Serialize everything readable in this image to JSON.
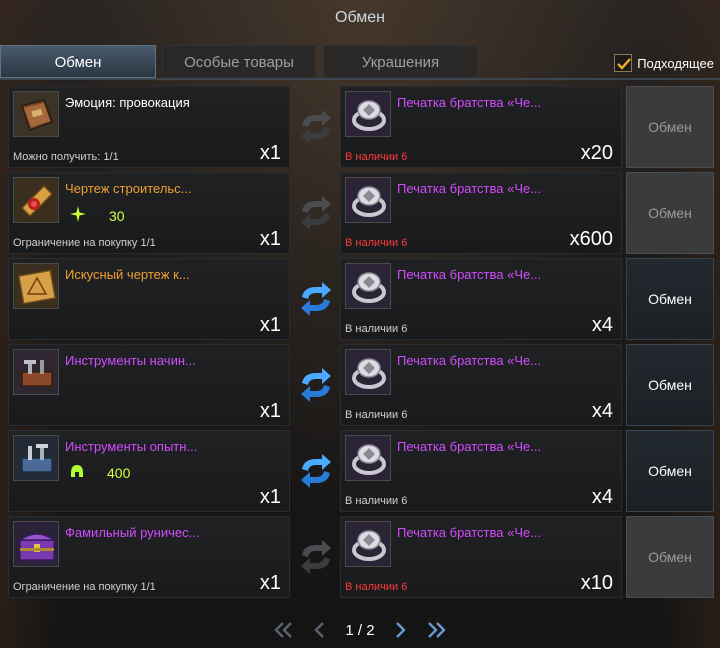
{
  "window": {
    "title": "Обмен"
  },
  "tabs": [
    {
      "label": "Обмен",
      "active": true
    },
    {
      "label": "Особые товары",
      "active": false
    },
    {
      "label": "Украшения",
      "active": false
    }
  ],
  "filter": {
    "label": "Подходящее",
    "checked": true
  },
  "exchange_button_label": "Обмен",
  "rows": [
    {
      "give": {
        "name": "Эмоция: провокация",
        "color": "white",
        "icon": "book-icon",
        "sub": "Можно получить: 1/1",
        "qty": "x1"
      },
      "get": {
        "name": "Печатка братства «Че...",
        "icon": "silver-ring-icon",
        "stock": "В наличии 6",
        "stock_red": true,
        "qty": "x20"
      },
      "swap_active": false,
      "enabled": false
    },
    {
      "give": {
        "name": "Чертеж строительс...",
        "color": "orange",
        "icon": "scroll-icon",
        "sub": "Ограничение на покупку 1/1",
        "qty": "x1",
        "bonus_icon": "sparkle-icon",
        "bonus_value": "30"
      },
      "get": {
        "name": "Печатка братства «Че...",
        "icon": "silver-ring-icon",
        "stock": "В наличии 6",
        "stock_red": true,
        "qty": "x600"
      },
      "swap_active": false,
      "enabled": false
    },
    {
      "give": {
        "name": "Искусный чертеж к...",
        "color": "orange",
        "icon": "blueprint-icon",
        "sub": "",
        "qty": "x1"
      },
      "get": {
        "name": "Печатка братства «Че...",
        "icon": "silver-ring-icon",
        "stock": "В наличии 6",
        "stock_red": false,
        "qty": "x4"
      },
      "swap_active": true,
      "enabled": true
    },
    {
      "give": {
        "name": "Инструменты начин...",
        "color": "purple",
        "icon": "toolbox-icon",
        "sub": "",
        "qty": "x1"
      },
      "get": {
        "name": "Печатка братства «Че...",
        "icon": "silver-ring-icon",
        "stock": "В наличии 6",
        "stock_red": false,
        "qty": "x4"
      },
      "swap_active": true,
      "enabled": true
    },
    {
      "give": {
        "name": "Инструменты опытн...",
        "color": "purple",
        "icon": "toolbox-blue-icon",
        "sub": "",
        "qty": "x1",
        "bonus_icon": "helmet-icon",
        "bonus_value": "400"
      },
      "get": {
        "name": "Печатка братства «Че...",
        "icon": "silver-ring-icon",
        "stock": "В наличии 6",
        "stock_red": false,
        "qty": "x4"
      },
      "swap_active": true,
      "enabled": true
    },
    {
      "give": {
        "name": "Фамильный руничес...",
        "color": "purple",
        "icon": "chest-icon",
        "sub": "Ограничение на покупку 1/1",
        "qty": "x1"
      },
      "get": {
        "name": "Печатка братства «Че...",
        "icon": "silver-ring-icon",
        "stock": "В наличии 6",
        "stock_red": true,
        "qty": "x10"
      },
      "swap_active": false,
      "enabled": false
    }
  ],
  "pager": {
    "text": "1 / 2"
  },
  "colors": {
    "orange": "#f0a030",
    "purple": "#d34cff",
    "red": "#ff3a3a",
    "lime": "#d8ff40",
    "swap_blue": "#3aa0ff"
  }
}
